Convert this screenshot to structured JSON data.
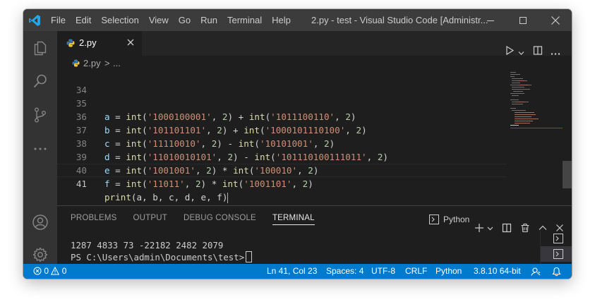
{
  "titlebar": {
    "menu": [
      "File",
      "Edit",
      "Selection",
      "View",
      "Go",
      "Run",
      "Terminal",
      "Help"
    ],
    "title": "2.py - test - Visual Studio Code [Administr..."
  },
  "tab": {
    "filename": "2.py"
  },
  "breadcrumb": {
    "file": "2.py",
    "separator": ">",
    "symbol": "..."
  },
  "editor": {
    "lines": [
      {
        "num": "34",
        "code": ""
      },
      {
        "num": "35",
        "var": "a",
        "left_str": "'1000100001'",
        "op": "+",
        "right_str": "'1011100110'",
        "base": "2"
      },
      {
        "num": "36",
        "var": "b",
        "left_str": "'101101101'",
        "op": "+",
        "right_str": "'1000101110100'",
        "base": "2"
      },
      {
        "num": "37",
        "var": "c",
        "left_str": "'11110010'",
        "op": "-",
        "right_str": "'10101001'",
        "base": "2"
      },
      {
        "num": "38",
        "var": "d",
        "left_str": "'11010010101'",
        "op": "-",
        "right_str": "'101110100111011'",
        "base": "2"
      },
      {
        "num": "39",
        "var": "e",
        "left_str": "'1001001'",
        "op": "*",
        "right_str": "'100010'",
        "base": "2"
      },
      {
        "num": "40",
        "var": "f",
        "left_str": "'11011'",
        "op": "*",
        "right_str": "'1001101'",
        "base": "2"
      },
      {
        "num": "41",
        "fn": "print",
        "args": "(a, b, c, d, e, f)"
      }
    ],
    "int_fn": "int"
  },
  "panel": {
    "tabs": [
      "PROBLEMS",
      "OUTPUT",
      "DEBUG CONSOLE",
      "TERMINAL"
    ],
    "active_tab": "TERMINAL",
    "terminal_name": "Python",
    "output_line": "1287 4833 73 -22182 2482 2079",
    "prompt": "PS C:\\Users\\admin\\Documents\\test>"
  },
  "statusbar": {
    "errors": "0",
    "warnings": "0",
    "position": "Ln 41, Col 23",
    "spaces": "Spaces: 4",
    "encoding": "UTF-8",
    "eol": "CRLF",
    "language": "Python",
    "interpreter": "3.8.10 64-bit"
  },
  "colors": {
    "accent": "#007acc",
    "titlebar": "#3c3c3c",
    "editor_bg": "#1e1e1e",
    "string": "#ce9178",
    "function": "#dcdcaa",
    "number": "#b5cea8"
  }
}
